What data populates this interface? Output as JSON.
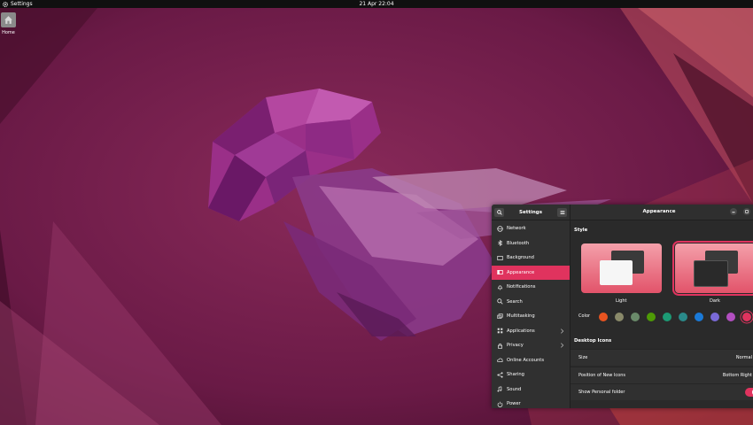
{
  "topbar": {
    "app_name": "Settings",
    "clock": "21 Apr  22:04"
  },
  "desktop": {
    "home_label": "Home"
  },
  "settings": {
    "sidebar_title": "Settings",
    "nav": [
      {
        "label": "Network",
        "icon": "network-icon"
      },
      {
        "label": "Bluetooth",
        "icon": "bluetooth-icon"
      },
      {
        "label": "Background",
        "icon": "background-icon"
      },
      {
        "label": "Appearance",
        "icon": "appearance-icon",
        "active": true
      },
      {
        "label": "Notifications",
        "icon": "bell-icon"
      },
      {
        "label": "Search",
        "icon": "search-icon"
      },
      {
        "label": "Multitasking",
        "icon": "multitasking-icon"
      },
      {
        "label": "Applications",
        "icon": "applications-icon",
        "chevron": true
      },
      {
        "label": "Privacy",
        "icon": "privacy-icon",
        "chevron": true
      },
      {
        "label": "Online Accounts",
        "icon": "cloud-icon"
      },
      {
        "label": "Sharing",
        "icon": "sharing-icon"
      },
      {
        "label": "Sound",
        "icon": "music-note-icon"
      },
      {
        "label": "Power",
        "icon": "power-icon"
      }
    ],
    "page_title": "Appearance",
    "style_section": "Style",
    "style_options": {
      "light": "Light",
      "dark": "Dark",
      "selected": "Dark"
    },
    "color_label": "Color",
    "accent_colors": [
      "#e95420",
      "#8a8a6a",
      "#6a8a6a",
      "#4e9a06",
      "#1c9a74",
      "#2a8a8a",
      "#1a7ad8",
      "#7a6ad8",
      "#b24fc0",
      "#e0335e"
    ],
    "selected_accent": "#e0335e",
    "desktop_icons_section": "Desktop Icons",
    "size_label": "Size",
    "size_value": "Normal",
    "position_label": "Position of New Icons",
    "position_value": "Bottom Right",
    "show_personal_label": "Show Personal folder",
    "show_personal_enabled": true
  }
}
